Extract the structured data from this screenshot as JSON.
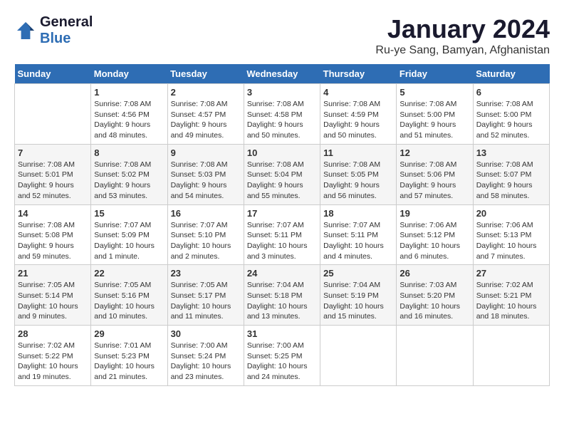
{
  "header": {
    "logo_line1": "General",
    "logo_line2": "Blue",
    "title": "January 2024",
    "subtitle": "Ru-ye Sang, Bamyan, Afghanistan"
  },
  "weekdays": [
    "Sunday",
    "Monday",
    "Tuesday",
    "Wednesday",
    "Thursday",
    "Friday",
    "Saturday"
  ],
  "weeks": [
    [
      {
        "day": "",
        "empty": true
      },
      {
        "day": "1",
        "sunrise": "7:08 AM",
        "sunset": "4:56 PM",
        "daylight": "9 hours and 48 minutes."
      },
      {
        "day": "2",
        "sunrise": "7:08 AM",
        "sunset": "4:57 PM",
        "daylight": "9 hours and 49 minutes."
      },
      {
        "day": "3",
        "sunrise": "7:08 AM",
        "sunset": "4:58 PM",
        "daylight": "9 hours and 50 minutes."
      },
      {
        "day": "4",
        "sunrise": "7:08 AM",
        "sunset": "4:59 PM",
        "daylight": "9 hours and 50 minutes."
      },
      {
        "day": "5",
        "sunrise": "7:08 AM",
        "sunset": "5:00 PM",
        "daylight": "9 hours and 51 minutes."
      },
      {
        "day": "6",
        "sunrise": "7:08 AM",
        "sunset": "5:00 PM",
        "daylight": "9 hours and 52 minutes."
      }
    ],
    [
      {
        "day": "7",
        "sunrise": "7:08 AM",
        "sunset": "5:01 PM",
        "daylight": "9 hours and 52 minutes."
      },
      {
        "day": "8",
        "sunrise": "7:08 AM",
        "sunset": "5:02 PM",
        "daylight": "9 hours and 53 minutes."
      },
      {
        "day": "9",
        "sunrise": "7:08 AM",
        "sunset": "5:03 PM",
        "daylight": "9 hours and 54 minutes."
      },
      {
        "day": "10",
        "sunrise": "7:08 AM",
        "sunset": "5:04 PM",
        "daylight": "9 hours and 55 minutes."
      },
      {
        "day": "11",
        "sunrise": "7:08 AM",
        "sunset": "5:05 PM",
        "daylight": "9 hours and 56 minutes."
      },
      {
        "day": "12",
        "sunrise": "7:08 AM",
        "sunset": "5:06 PM",
        "daylight": "9 hours and 57 minutes."
      },
      {
        "day": "13",
        "sunrise": "7:08 AM",
        "sunset": "5:07 PM",
        "daylight": "9 hours and 58 minutes."
      }
    ],
    [
      {
        "day": "14",
        "sunrise": "7:08 AM",
        "sunset": "5:08 PM",
        "daylight": "9 hours and 59 minutes."
      },
      {
        "day": "15",
        "sunrise": "7:07 AM",
        "sunset": "5:09 PM",
        "daylight": "10 hours and 1 minute."
      },
      {
        "day": "16",
        "sunrise": "7:07 AM",
        "sunset": "5:10 PM",
        "daylight": "10 hours and 2 minutes."
      },
      {
        "day": "17",
        "sunrise": "7:07 AM",
        "sunset": "5:11 PM",
        "daylight": "10 hours and 3 minutes."
      },
      {
        "day": "18",
        "sunrise": "7:07 AM",
        "sunset": "5:11 PM",
        "daylight": "10 hours and 4 minutes."
      },
      {
        "day": "19",
        "sunrise": "7:06 AM",
        "sunset": "5:12 PM",
        "daylight": "10 hours and 6 minutes."
      },
      {
        "day": "20",
        "sunrise": "7:06 AM",
        "sunset": "5:13 PM",
        "daylight": "10 hours and 7 minutes."
      }
    ],
    [
      {
        "day": "21",
        "sunrise": "7:05 AM",
        "sunset": "5:14 PM",
        "daylight": "10 hours and 9 minutes."
      },
      {
        "day": "22",
        "sunrise": "7:05 AM",
        "sunset": "5:16 PM",
        "daylight": "10 hours and 10 minutes."
      },
      {
        "day": "23",
        "sunrise": "7:05 AM",
        "sunset": "5:17 PM",
        "daylight": "10 hours and 11 minutes."
      },
      {
        "day": "24",
        "sunrise": "7:04 AM",
        "sunset": "5:18 PM",
        "daylight": "10 hours and 13 minutes."
      },
      {
        "day": "25",
        "sunrise": "7:04 AM",
        "sunset": "5:19 PM",
        "daylight": "10 hours and 15 minutes."
      },
      {
        "day": "26",
        "sunrise": "7:03 AM",
        "sunset": "5:20 PM",
        "daylight": "10 hours and 16 minutes."
      },
      {
        "day": "27",
        "sunrise": "7:02 AM",
        "sunset": "5:21 PM",
        "daylight": "10 hours and 18 minutes."
      }
    ],
    [
      {
        "day": "28",
        "sunrise": "7:02 AM",
        "sunset": "5:22 PM",
        "daylight": "10 hours and 19 minutes."
      },
      {
        "day": "29",
        "sunrise": "7:01 AM",
        "sunset": "5:23 PM",
        "daylight": "10 hours and 21 minutes."
      },
      {
        "day": "30",
        "sunrise": "7:00 AM",
        "sunset": "5:24 PM",
        "daylight": "10 hours and 23 minutes."
      },
      {
        "day": "31",
        "sunrise": "7:00 AM",
        "sunset": "5:25 PM",
        "daylight": "10 hours and 24 minutes."
      },
      {
        "day": "",
        "empty": true
      },
      {
        "day": "",
        "empty": true
      },
      {
        "day": "",
        "empty": true
      }
    ]
  ]
}
